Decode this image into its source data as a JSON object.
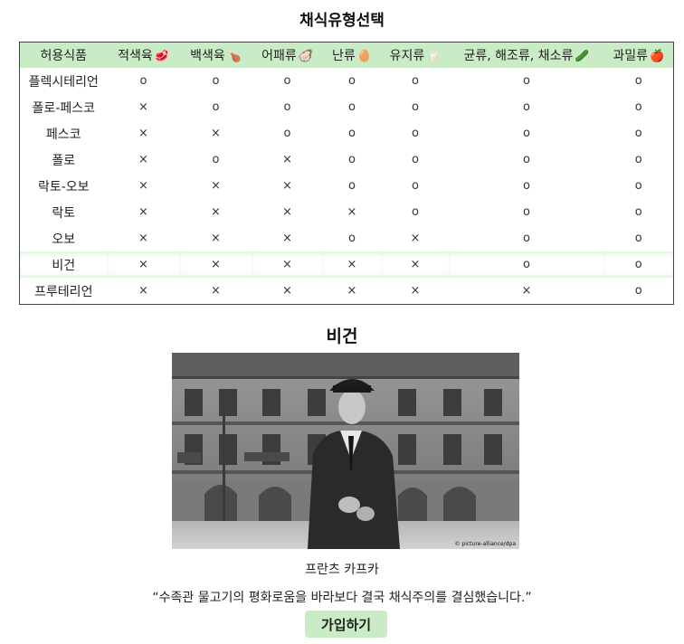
{
  "page": {
    "title": "채식유형선택"
  },
  "table": {
    "header": [
      {
        "label": "허용식품",
        "icon": ""
      },
      {
        "label": "적색육",
        "icon": "🥩"
      },
      {
        "label": "백색육",
        "icon": "🍗"
      },
      {
        "label": "어패류",
        "icon": "🦪"
      },
      {
        "label": "난류",
        "icon": "🥚"
      },
      {
        "label": "유지류",
        "icon": "🥛"
      },
      {
        "label": "균류, 해조류, 채소류",
        "icon": "🥒"
      },
      {
        "label": "과밀류",
        "icon": "🍎"
      }
    ],
    "rows": [
      {
        "name": "플렉시테리언",
        "cells": [
          "o",
          "o",
          "o",
          "o",
          "o",
          "o",
          "o"
        ]
      },
      {
        "name": "폴로-페스코",
        "cells": [
          "×",
          "o",
          "o",
          "o",
          "o",
          "o",
          "o"
        ]
      },
      {
        "name": "페스코",
        "cells": [
          "×",
          "×",
          "o",
          "o",
          "o",
          "o",
          "o"
        ]
      },
      {
        "name": "폴로",
        "cells": [
          "×",
          "o",
          "×",
          "o",
          "o",
          "o",
          "o"
        ]
      },
      {
        "name": "락토-오보",
        "cells": [
          "×",
          "×",
          "×",
          "o",
          "o",
          "o",
          "o"
        ]
      },
      {
        "name": "락토",
        "cells": [
          "×",
          "×",
          "×",
          "×",
          "o",
          "o",
          "o"
        ]
      },
      {
        "name": "오보",
        "cells": [
          "×",
          "×",
          "×",
          "o",
          "×",
          "o",
          "o"
        ]
      },
      {
        "name": "비건",
        "cells": [
          "×",
          "×",
          "×",
          "×",
          "×",
          "o",
          "o"
        ]
      },
      {
        "name": "프루테리언",
        "cells": [
          "×",
          "×",
          "×",
          "×",
          "×",
          "×",
          "o"
        ]
      }
    ],
    "selected_row": "비건"
  },
  "detail": {
    "title": "비건",
    "caption": "프란츠 카프카",
    "quote": "“수족관 물고기의 평화로움을 바라보다 결국 채식주의를 결심했습니다.”",
    "photo_credit": "© picture-alliance/dpa",
    "join_label": "가입하기"
  },
  "colors": {
    "accent": "#c9ecc6",
    "border": "#444444"
  }
}
